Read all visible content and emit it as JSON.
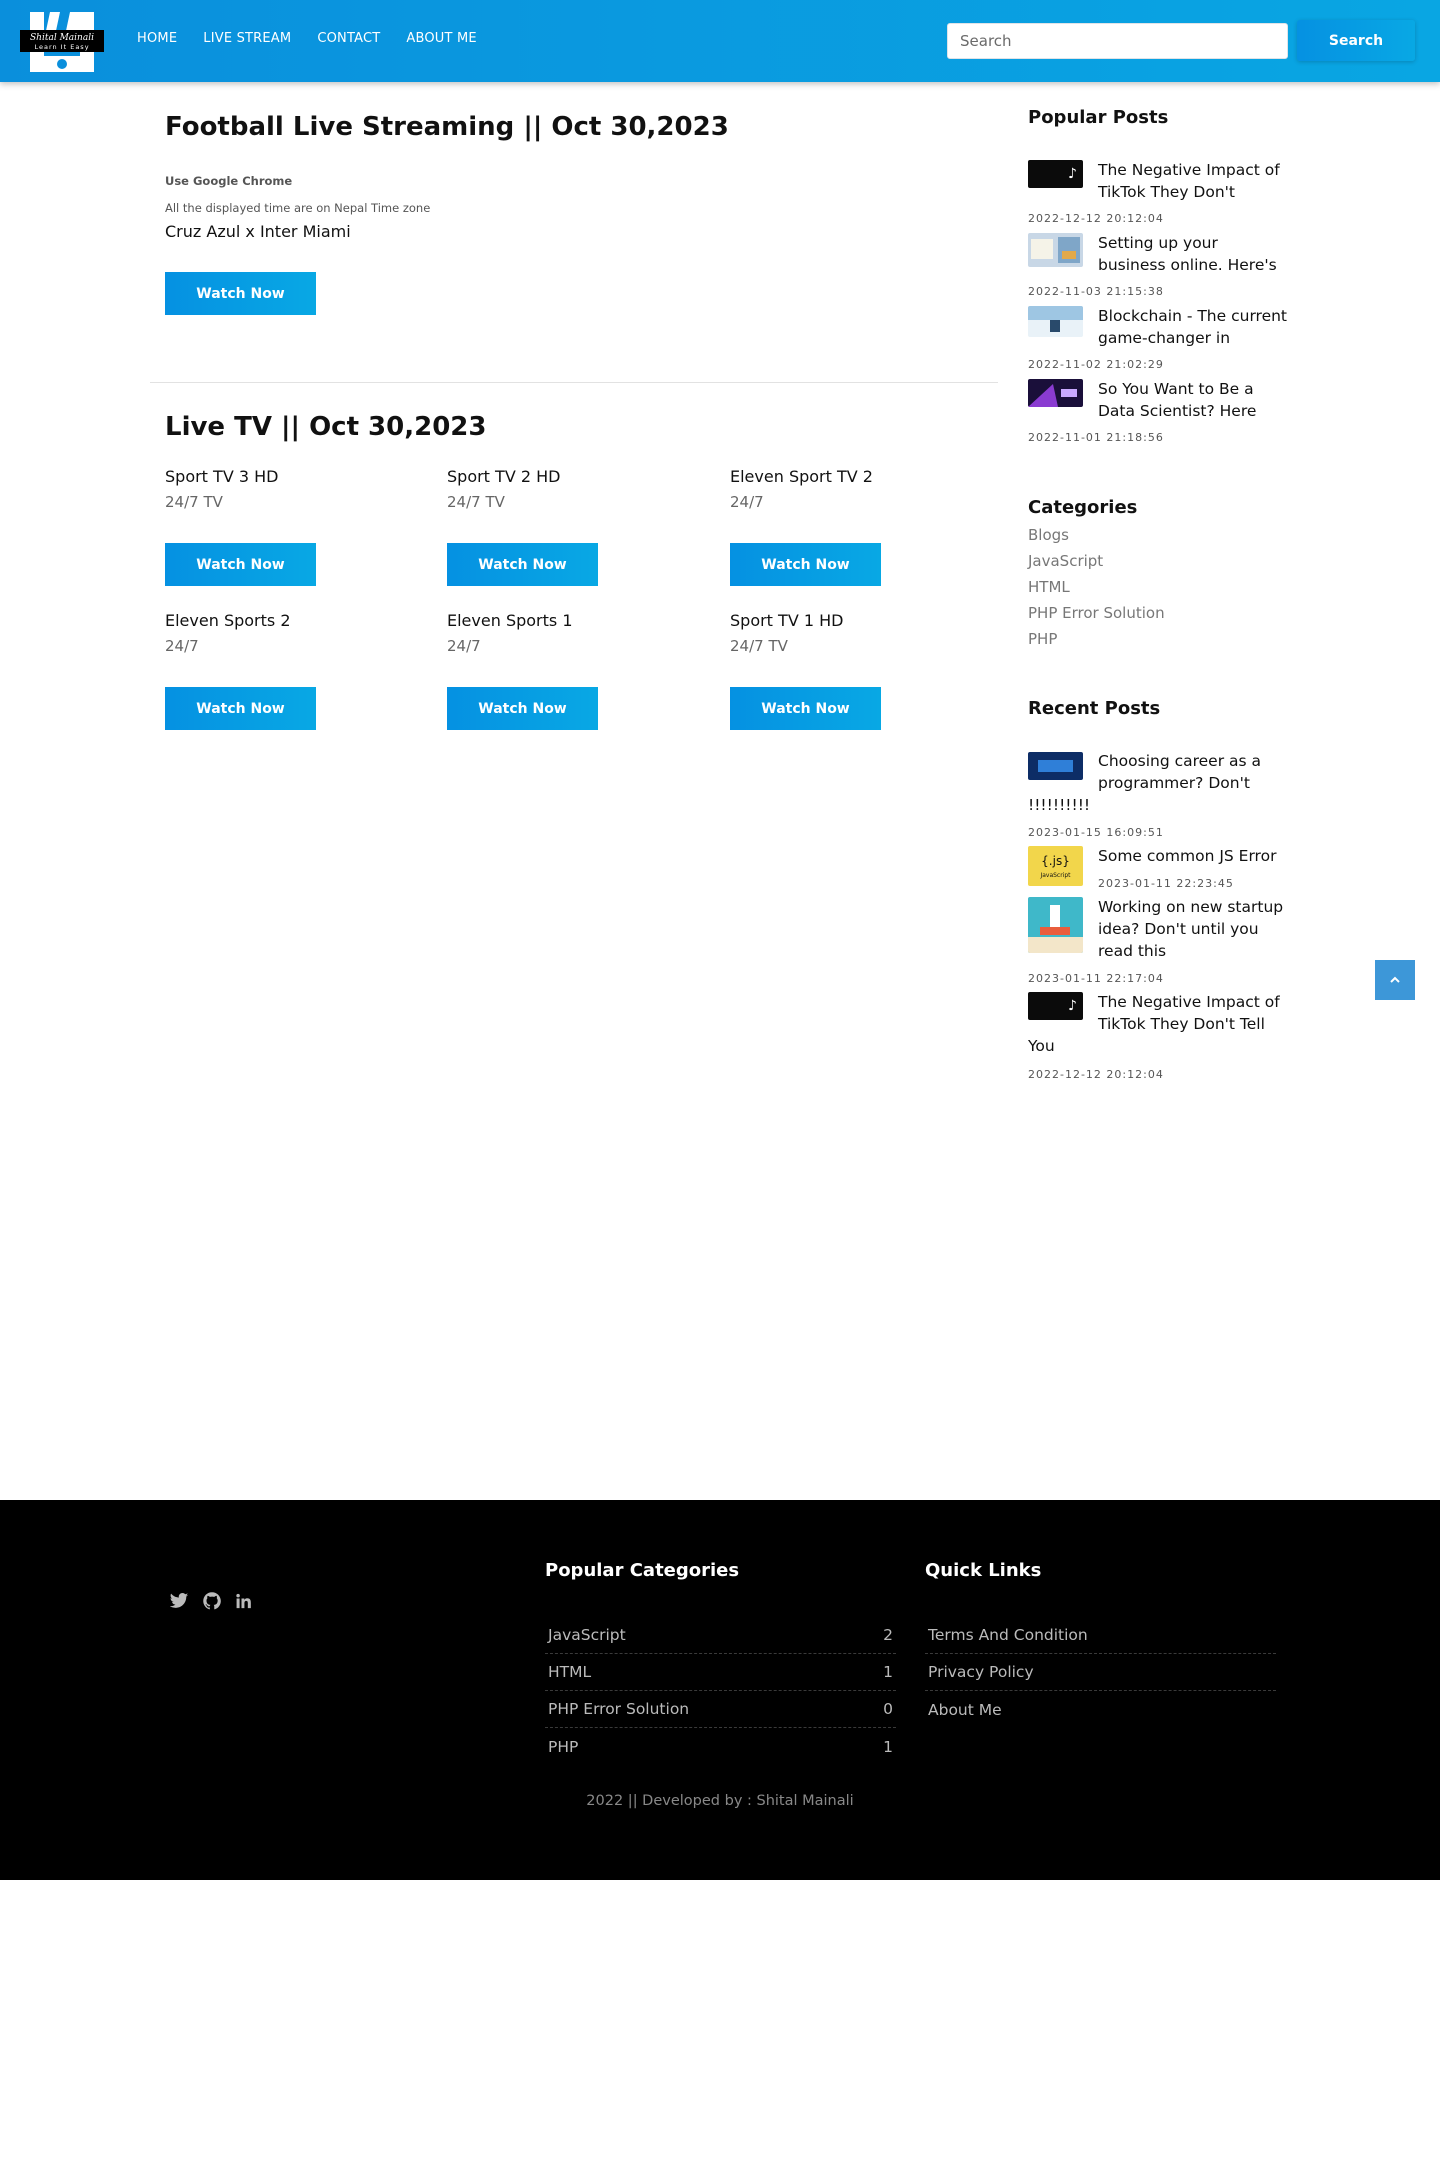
{
  "nav": {
    "logo_text_1": "Shital Mainali",
    "logo_text_2": "Learn It Easy",
    "links": [
      "HOME",
      "LIVE STREAM",
      "CONTACT",
      "ABOUT ME"
    ],
    "search_placeholder": "Search",
    "search_button": "Search"
  },
  "football": {
    "title": "Football Live Streaming || Oct 30,2023",
    "browser_note": "Use Google Chrome",
    "timezone_note": "All the displayed time are on Nepal Time zone",
    "match": "Cruz Azul x Inter Miami",
    "watch_label": "Watch Now"
  },
  "live_tv": {
    "title": "Live TV || Oct 30,2023",
    "channels": [
      {
        "name": "Sport TV 3 HD",
        "sub": "24/7 TV",
        "button": "Watch Now"
      },
      {
        "name": "Sport TV 2 HD",
        "sub": "24/7 TV",
        "button": "Watch Now"
      },
      {
        "name": "Eleven Sport TV 2",
        "sub": "24/7",
        "button": "Watch Now"
      },
      {
        "name": "Eleven Sports 2",
        "sub": "24/7",
        "button": "Watch Now"
      },
      {
        "name": "Eleven Sports 1",
        "sub": "24/7",
        "button": "Watch Now"
      },
      {
        "name": "Sport TV 1 HD",
        "sub": "24/7 TV",
        "button": "Watch Now"
      }
    ]
  },
  "sidebar": {
    "popular_title": "Popular Posts",
    "popular_posts": [
      {
        "title_1": "The Negative Impact of",
        "title_2": "TikTok They Don't",
        "date": "2022-12-12 20:12:04"
      },
      {
        "title_1": "Setting up your",
        "title_2": "business online. Here's",
        "date": "2022-11-03 21:15:38"
      },
      {
        "title_1": "Blockchain - The current",
        "title_2": "game-changer in",
        "date": "2022-11-02 21:02:29"
      },
      {
        "title_1": "So You Want to Be a",
        "title_2": "Data Scientist? Here",
        "date": "2022-11-01 21:18:56"
      }
    ],
    "categories_title": "Categories",
    "categories": [
      "Blogs",
      "JavaScript",
      "HTML",
      "PHP Error Solution",
      "PHP"
    ],
    "recent_title": "Recent Posts",
    "recent_posts": [
      {
        "lines": [
          "Choosing career as a",
          "programmer? Don't",
          "!!!!!!!!!!"
        ],
        "date": "2023-01-15 16:09:51"
      },
      {
        "lines": [
          "Some common JS Error"
        ],
        "date": "2023-01-11 22:23:45"
      },
      {
        "lines": [
          "Working on new startup",
          "idea? Don't until you",
          "read this"
        ],
        "date": "2023-01-11 22:17:04"
      },
      {
        "lines": [
          "The Negative Impact of",
          "TikTok They Don't Tell",
          "You"
        ],
        "date": "2022-12-12 20:12:04"
      }
    ],
    "js_thumb_1": "{.js}",
    "js_thumb_2": "JavaScript"
  },
  "footer": {
    "popular_categories_title": "Popular Categories",
    "popular_categories": [
      {
        "name": "JavaScript",
        "count": "2"
      },
      {
        "name": "HTML",
        "count": "1"
      },
      {
        "name": "PHP Error Solution",
        "count": "0"
      },
      {
        "name": "PHP",
        "count": "1"
      }
    ],
    "quick_links_title": "Quick Links",
    "quick_links": [
      "Terms And Condition",
      "Privacy Policy",
      "About Me"
    ],
    "copyright": "2022 || Developed by : Shital Mainali"
  },
  "colors": {
    "nav_gradient_start": "#0a8fdc",
    "nav_gradient_end": "#09a6e3",
    "button_blue": "#0591e2",
    "footer_bg": "#000000",
    "scroll_top_bg": "#3d97d8"
  },
  "icons": [
    "twitter-icon",
    "github-icon",
    "linkedin-icon",
    "chevron-up-icon"
  ]
}
